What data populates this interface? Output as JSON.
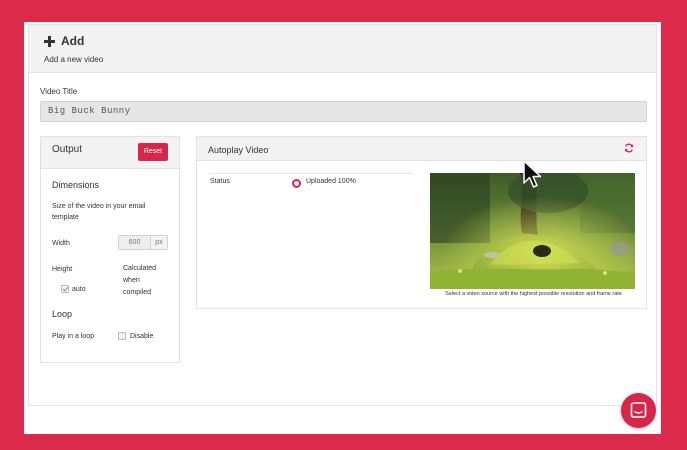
{
  "header": {
    "icon": "plus-icon",
    "title": "Add",
    "subtitle": "Add a new video"
  },
  "video_title": {
    "label": "Video Title",
    "value": "Big Buck Bunny"
  },
  "output": {
    "title": "Output",
    "reset_label": "Reset",
    "dimensions_title": "Dimensions",
    "dimensions_desc_line1": "Size of the video in your email",
    "dimensions_desc_line2": "template",
    "width_label": "Width",
    "width_value": "600",
    "width_unit": "px",
    "height_label": "Height",
    "height_calc_line1": "Calculated",
    "height_calc_line2": "when",
    "height_calc_line3": "compiled",
    "auto_label": "auto",
    "auto_checked": true,
    "loop_title": "Loop",
    "loop_label": "Play in a loop",
    "disable_label": "Disable",
    "disable_checked": false
  },
  "autoplay": {
    "title": "Autoplay Video",
    "refresh_icon": "refresh-icon",
    "status_label": "Status",
    "status_value": "Uploaded 100%",
    "caption": "Select a video source with the highest possible resolution and frame rate"
  },
  "colors": {
    "brand": "#d7264a",
    "frame": "#dc2a4b",
    "panel_header": "#f3f3f3"
  },
  "chat_icon": "chat-bubble-icon"
}
